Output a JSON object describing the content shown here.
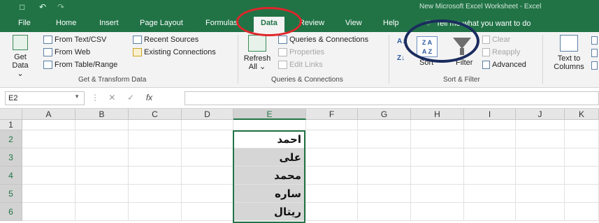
{
  "window": {
    "title": "New Microsoft Excel Worksheet - Excel"
  },
  "tabs": [
    "File",
    "Home",
    "Insert",
    "Page Layout",
    "Formulas",
    "Data",
    "Review",
    "View",
    "Help"
  ],
  "active_tab": "Data",
  "tell_me": "Tell me what you want to do",
  "ribbon": {
    "get_transform": {
      "get_data_line1": "Get",
      "get_data_line2": "Data ⌄",
      "from_text_csv": "From Text/CSV",
      "from_web": "From Web",
      "from_table_range": "From Table/Range",
      "recent_sources": "Recent Sources",
      "existing_connections": "Existing Connections",
      "label": "Get & Transform Data"
    },
    "queries": {
      "refresh_line1": "Refresh",
      "refresh_line2": "All ⌄",
      "queries_connections": "Queries & Connections",
      "properties": "Properties",
      "edit_links": "Edit Links",
      "label": "Queries & Connections"
    },
    "sort_filter": {
      "sort": "Sort",
      "filter": "Filter",
      "clear": "Clear",
      "reapply": "Reapply",
      "advanced": "Advanced",
      "label": "Sort & Filter"
    },
    "data_tools": {
      "text_to_columns_line1": "Text to",
      "text_to_columns_line2": "Columns"
    }
  },
  "formula_bar": {
    "name_box": "E2",
    "fx": "fx",
    "value": ""
  },
  "grid": {
    "columns": [
      "A",
      "B",
      "C",
      "D",
      "E",
      "F",
      "G",
      "H",
      "I",
      "J",
      "K"
    ],
    "rows": [
      "1",
      "2",
      "3",
      "4",
      "5",
      "6"
    ],
    "selected_column": "E",
    "column_e_values": [
      "احمد",
      "على",
      "محمد",
      "ساره",
      "ريتال"
    ]
  },
  "colors": {
    "excel_green": "#217346",
    "annotation_red": "#e0262b",
    "annotation_navy": "#1a2c5e"
  }
}
